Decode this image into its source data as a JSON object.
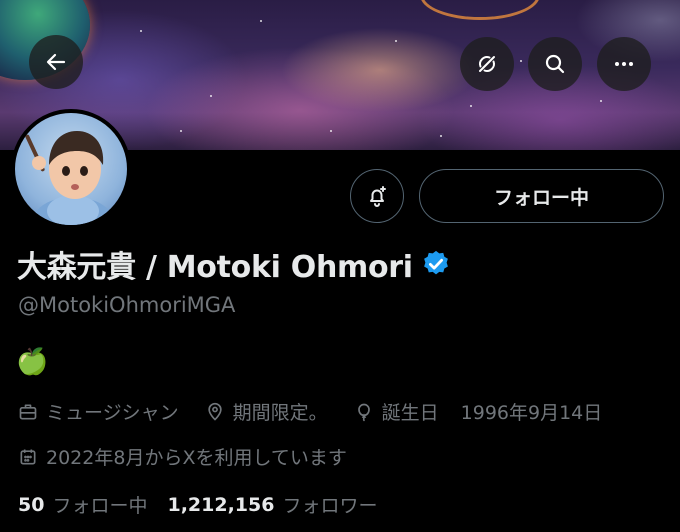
{
  "header": {
    "back_icon": "arrow-left-icon",
    "grok_icon": "grok-icon",
    "search_icon": "search-icon",
    "more_icon": "more-horizontal-icon"
  },
  "profile": {
    "display_name": "大森元貴 / Motoki Ohmori",
    "verified": true,
    "handle": "@MotokiOhmoriMGA",
    "bio": "🍏",
    "category": "ミュージシャン",
    "location": "期間限定。",
    "birthday_label": "誕生日",
    "birthday_value": "1996年9月14日",
    "joined": "2022年8月からXを利用しています",
    "following_count": "50",
    "following_label": "フォロー中",
    "followers_count": "1,212,156",
    "followers_label": "フォロワー"
  },
  "actions": {
    "notify_icon": "bell-plus-icon",
    "follow_button_label": "フォロー中"
  },
  "colors": {
    "background": "#000000",
    "text_primary": "#e7e9ea",
    "text_secondary": "#71767b",
    "border": "#536471",
    "verified_blue": "#1d9bf0"
  }
}
